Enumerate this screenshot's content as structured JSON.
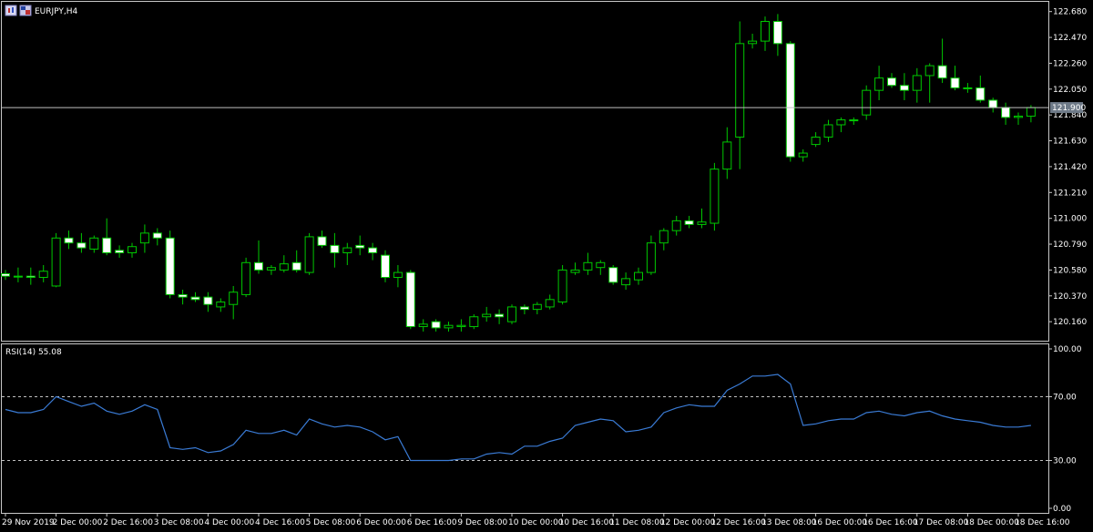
{
  "window": {
    "symbol_title": "EURJPY,H4",
    "icons": [
      "chart-type-icon",
      "flag-icon"
    ]
  },
  "colors": {
    "background": "#000000",
    "frame": "#c8c8c8",
    "bull_body": "#000000",
    "bull_outline": "#00c800",
    "bear_body": "#ffffff",
    "bear_outline": "#00c800",
    "wick": "#00c800",
    "rsi_line": "#3a7bd5",
    "level_line": "#c0c0c0"
  },
  "chart_data": [
    {
      "type": "candlestick",
      "symbol": "EURJPY",
      "timeframe": "H4",
      "ylim": [
        120.05,
        122.7
      ],
      "y_ticks": [
        "122.680",
        "122.470",
        "122.260",
        "122.050",
        "121.840",
        "121.630",
        "121.420",
        "121.210",
        "121.000",
        "120.790",
        "120.580",
        "120.370",
        "120.160"
      ],
      "y_tick_values": [
        122.68,
        122.47,
        122.26,
        122.05,
        121.84,
        121.63,
        121.42,
        121.21,
        121.0,
        120.79,
        120.58,
        120.37,
        120.16
      ],
      "current_price": 121.9,
      "current_price_label": "121.900",
      "x_labels": [
        "29 Nov 2019",
        "2 Dec 00:00",
        "2 Dec 16:00",
        "3 Dec 08:00",
        "4 Dec 00:00",
        "4 Dec 16:00",
        "5 Dec 08:00",
        "6 Dec 00:00",
        "6 Dec 16:00",
        "9 Dec 08:00",
        "10 Dec 00:00",
        "10 Dec 16:00",
        "11 Dec 08:00",
        "12 Dec 00:00",
        "12 Dec 16:00",
        "13 Dec 08:00",
        "16 Dec 00:00",
        "16 Dec 16:00",
        "17 Dec 08:00",
        "18 Dec 00:00",
        "18 Dec 16:00"
      ],
      "x_label_index": [
        0,
        4,
        8,
        12,
        16,
        20,
        24,
        28,
        32,
        36,
        40,
        44,
        48,
        52,
        56,
        60,
        64,
        68,
        72,
        76,
        80
      ],
      "candles": [
        {
          "o": 120.55,
          "h": 120.58,
          "l": 120.5,
          "c": 120.53
        },
        {
          "o": 120.53,
          "h": 120.6,
          "l": 120.48,
          "c": 120.53
        },
        {
          "o": 120.53,
          "h": 120.6,
          "l": 120.46,
          "c": 120.52
        },
        {
          "o": 120.52,
          "h": 120.62,
          "l": 120.48,
          "c": 120.57
        },
        {
          "o": 120.45,
          "h": 120.88,
          "l": 120.44,
          "c": 120.84
        },
        {
          "o": 120.84,
          "h": 120.9,
          "l": 120.75,
          "c": 120.8
        },
        {
          "o": 120.8,
          "h": 120.88,
          "l": 120.72,
          "c": 120.76
        },
        {
          "o": 120.75,
          "h": 120.86,
          "l": 120.72,
          "c": 120.84
        },
        {
          "o": 120.84,
          "h": 121.0,
          "l": 120.7,
          "c": 120.72
        },
        {
          "o": 120.74,
          "h": 120.78,
          "l": 120.68,
          "c": 120.72
        },
        {
          "o": 120.72,
          "h": 120.8,
          "l": 120.68,
          "c": 120.77
        },
        {
          "o": 120.8,
          "h": 120.95,
          "l": 120.72,
          "c": 120.88
        },
        {
          "o": 120.88,
          "h": 120.92,
          "l": 120.78,
          "c": 120.84
        },
        {
          "o": 120.84,
          "h": 120.9,
          "l": 120.35,
          "c": 120.38
        },
        {
          "o": 120.38,
          "h": 120.42,
          "l": 120.3,
          "c": 120.36
        },
        {
          "o": 120.36,
          "h": 120.4,
          "l": 120.32,
          "c": 120.34
        },
        {
          "o": 120.36,
          "h": 120.4,
          "l": 120.24,
          "c": 120.3
        },
        {
          "o": 120.28,
          "h": 120.35,
          "l": 120.24,
          "c": 120.32
        },
        {
          "o": 120.3,
          "h": 120.45,
          "l": 120.18,
          "c": 120.4
        },
        {
          "o": 120.38,
          "h": 120.68,
          "l": 120.36,
          "c": 120.64
        },
        {
          "o": 120.64,
          "h": 120.82,
          "l": 120.55,
          "c": 120.58
        },
        {
          "o": 120.58,
          "h": 120.62,
          "l": 120.54,
          "c": 120.6
        },
        {
          "o": 120.58,
          "h": 120.7,
          "l": 120.56,
          "c": 120.63
        },
        {
          "o": 120.64,
          "h": 120.74,
          "l": 120.56,
          "c": 120.58
        },
        {
          "o": 120.56,
          "h": 120.88,
          "l": 120.54,
          "c": 120.85
        },
        {
          "o": 120.85,
          "h": 120.9,
          "l": 120.76,
          "c": 120.78
        },
        {
          "o": 120.78,
          "h": 120.88,
          "l": 120.6,
          "c": 120.72
        },
        {
          "o": 120.72,
          "h": 120.8,
          "l": 120.62,
          "c": 120.76
        },
        {
          "o": 120.78,
          "h": 120.86,
          "l": 120.7,
          "c": 120.76
        },
        {
          "o": 120.76,
          "h": 120.8,
          "l": 120.66,
          "c": 120.72
        },
        {
          "o": 120.7,
          "h": 120.74,
          "l": 120.48,
          "c": 120.52
        },
        {
          "o": 120.52,
          "h": 120.62,
          "l": 120.44,
          "c": 120.56
        },
        {
          "o": 120.56,
          "h": 120.58,
          "l": 120.1,
          "c": 120.12
        },
        {
          "o": 120.12,
          "h": 120.18,
          "l": 120.08,
          "c": 120.14
        },
        {
          "o": 120.16,
          "h": 120.18,
          "l": 120.08,
          "c": 120.11
        },
        {
          "o": 120.11,
          "h": 120.16,
          "l": 120.08,
          "c": 120.13
        },
        {
          "o": 120.12,
          "h": 120.18,
          "l": 120.08,
          "c": 120.13
        },
        {
          "o": 120.12,
          "h": 120.22,
          "l": 120.1,
          "c": 120.2
        },
        {
          "o": 120.2,
          "h": 120.28,
          "l": 120.16,
          "c": 120.22
        },
        {
          "o": 120.22,
          "h": 120.26,
          "l": 120.14,
          "c": 120.2
        },
        {
          "o": 120.16,
          "h": 120.3,
          "l": 120.14,
          "c": 120.28
        },
        {
          "o": 120.28,
          "h": 120.3,
          "l": 120.22,
          "c": 120.26
        },
        {
          "o": 120.26,
          "h": 120.32,
          "l": 120.22,
          "c": 120.3
        },
        {
          "o": 120.28,
          "h": 120.38,
          "l": 120.26,
          "c": 120.34
        },
        {
          "o": 120.32,
          "h": 120.62,
          "l": 120.3,
          "c": 120.58
        },
        {
          "o": 120.56,
          "h": 120.64,
          "l": 120.54,
          "c": 120.58
        },
        {
          "o": 120.58,
          "h": 120.72,
          "l": 120.54,
          "c": 120.64
        },
        {
          "o": 120.6,
          "h": 120.66,
          "l": 120.54,
          "c": 120.64
        },
        {
          "o": 120.6,
          "h": 120.62,
          "l": 120.46,
          "c": 120.48
        },
        {
          "o": 120.46,
          "h": 120.56,
          "l": 120.42,
          "c": 120.51
        },
        {
          "o": 120.5,
          "h": 120.6,
          "l": 120.46,
          "c": 120.56
        },
        {
          "o": 120.56,
          "h": 120.86,
          "l": 120.54,
          "c": 120.8
        },
        {
          "o": 120.8,
          "h": 120.92,
          "l": 120.74,
          "c": 120.9
        },
        {
          "o": 120.9,
          "h": 121.02,
          "l": 120.86,
          "c": 120.98
        },
        {
          "o": 120.98,
          "h": 121.02,
          "l": 120.92,
          "c": 120.95
        },
        {
          "o": 120.95,
          "h": 121.08,
          "l": 120.92,
          "c": 120.97
        },
        {
          "o": 120.96,
          "h": 121.45,
          "l": 120.9,
          "c": 121.4
        },
        {
          "o": 121.4,
          "h": 121.74,
          "l": 121.32,
          "c": 121.62
        },
        {
          "o": 121.66,
          "h": 122.6,
          "l": 121.4,
          "c": 122.42
        },
        {
          "o": 122.42,
          "h": 122.5,
          "l": 122.38,
          "c": 122.44
        },
        {
          "o": 122.44,
          "h": 122.64,
          "l": 122.36,
          "c": 122.6
        },
        {
          "o": 122.6,
          "h": 122.66,
          "l": 122.32,
          "c": 122.42
        },
        {
          "o": 122.42,
          "h": 122.44,
          "l": 121.46,
          "c": 121.5
        },
        {
          "o": 121.5,
          "h": 121.56,
          "l": 121.46,
          "c": 121.53
        },
        {
          "o": 121.6,
          "h": 121.7,
          "l": 121.58,
          "c": 121.66
        },
        {
          "o": 121.66,
          "h": 121.8,
          "l": 121.62,
          "c": 121.76
        },
        {
          "o": 121.76,
          "h": 121.82,
          "l": 121.7,
          "c": 121.8
        },
        {
          "o": 121.8,
          "h": 121.82,
          "l": 121.76,
          "c": 121.8
        },
        {
          "o": 121.84,
          "h": 122.08,
          "l": 121.8,
          "c": 122.04
        },
        {
          "o": 122.04,
          "h": 122.24,
          "l": 121.96,
          "c": 122.14
        },
        {
          "o": 122.14,
          "h": 122.18,
          "l": 122.06,
          "c": 122.08
        },
        {
          "o": 122.08,
          "h": 122.18,
          "l": 121.96,
          "c": 122.04
        },
        {
          "o": 122.04,
          "h": 122.22,
          "l": 121.94,
          "c": 122.16
        },
        {
          "o": 122.16,
          "h": 122.26,
          "l": 121.94,
          "c": 122.24
        },
        {
          "o": 122.24,
          "h": 122.46,
          "l": 122.1,
          "c": 122.14
        },
        {
          "o": 122.14,
          "h": 122.24,
          "l": 122.04,
          "c": 122.06
        },
        {
          "o": 122.06,
          "h": 122.1,
          "l": 122.02,
          "c": 122.06
        },
        {
          "o": 122.06,
          "h": 122.16,
          "l": 121.94,
          "c": 121.96
        },
        {
          "o": 121.96,
          "h": 121.98,
          "l": 121.86,
          "c": 121.9
        },
        {
          "o": 121.9,
          "h": 121.94,
          "l": 121.76,
          "c": 121.82
        },
        {
          "o": 121.82,
          "h": 121.86,
          "l": 121.76,
          "c": 121.83
        },
        {
          "o": 121.83,
          "h": 121.92,
          "l": 121.78,
          "c": 121.9
        }
      ]
    },
    {
      "type": "line",
      "indicator_label": "RSI(14) 55.08",
      "ylim": [
        0,
        100
      ],
      "y_ticks": [
        "100.00",
        "70.00",
        "30.00",
        "0.00"
      ],
      "y_tick_values": [
        100,
        70,
        30,
        0
      ],
      "levels": [
        70,
        30
      ],
      "series": [
        {
          "values": [
            62,
            60,
            60,
            62,
            70,
            67,
            64,
            66,
            61,
            59,
            61,
            65,
            62,
            38,
            37,
            38,
            35,
            36,
            40,
            49,
            47,
            47,
            49,
            46,
            56,
            53,
            51,
            52,
            51,
            48,
            43,
            45,
            30,
            30,
            30,
            30,
            31,
            31,
            34,
            35,
            34,
            39,
            39,
            42,
            44,
            52,
            54,
            56,
            55,
            48,
            49,
            51,
            60,
            63,
            65,
            64,
            64,
            74,
            78,
            83,
            83,
            84,
            78,
            52,
            53,
            55,
            56,
            56,
            60,
            61,
            59,
            58,
            60,
            61,
            58,
            56,
            55,
            54,
            52,
            51,
            51,
            52
          ]
        }
      ]
    }
  ]
}
